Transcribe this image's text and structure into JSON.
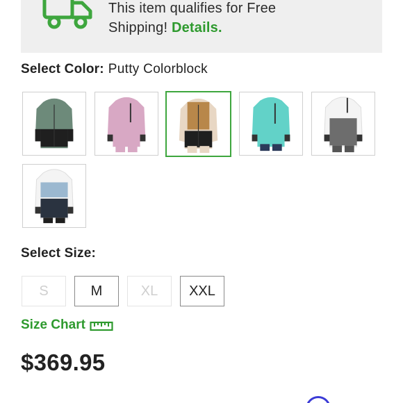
{
  "shipping": {
    "line1": "This item qualifies for Free",
    "line2": "Shipping!",
    "details": "Details."
  },
  "color": {
    "label": "Select Color:",
    "value": "Putty Colorblock",
    "swatches": [
      {
        "name": "sage",
        "body": "#6d8a7a",
        "bottom": "#1f1f1f",
        "selected": false
      },
      {
        "name": "pink",
        "body": "#d8a8c4",
        "bottom": "#d8a8c4",
        "selected": false
      },
      {
        "name": "putty",
        "body": "#b8874a",
        "bottom": "#1f1f1f",
        "selected": true
      },
      {
        "name": "aqua",
        "body": "#62d2c8",
        "bottom": "#62d2c8",
        "selected": false
      },
      {
        "name": "grey-white",
        "body": "#6d6d6d",
        "bottom": "#f4f4f4",
        "selected": false
      },
      {
        "name": "blue-white",
        "body": "#9bb8d0",
        "bottom": "#1f1f1f",
        "selected": false
      }
    ]
  },
  "size": {
    "label": "Select Size:",
    "options": [
      {
        "label": "S",
        "available": false
      },
      {
        "label": "M",
        "available": true
      },
      {
        "label": "XL",
        "available": false
      },
      {
        "label": "XXL",
        "available": true
      }
    ],
    "chart_label": "Size Chart"
  },
  "price": "$369.95",
  "colors": {
    "accent": "#2e9a2e",
    "banner_bg": "#efefef"
  }
}
